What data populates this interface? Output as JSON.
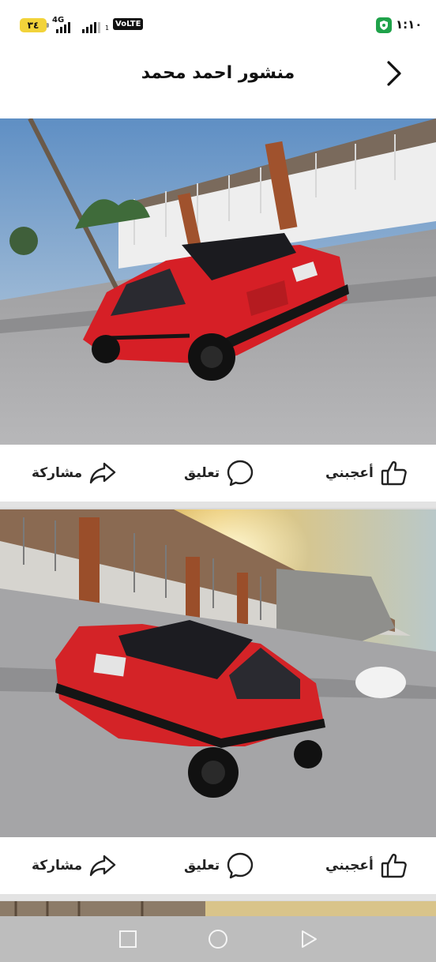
{
  "status_bar": {
    "battery_level": "٣٤",
    "network_type": "4G",
    "volte_label": "VoLTE",
    "sim_index": "1",
    "time": "١:١٠"
  },
  "header": {
    "title": "منشور احمد محمد"
  },
  "posts": [
    {
      "like_label": "أعجبني",
      "comment_label": "تعليق",
      "share_label": "مشاركة"
    },
    {
      "like_label": "أعجبني",
      "comment_label": "تعليق",
      "share_label": "مشاركة"
    }
  ],
  "colors": {
    "car_red": "#e0242a",
    "vpn_green": "#1fa24a",
    "battery_yellow": "#f2d33a",
    "nav_bar": "#bdbdbd"
  },
  "icons": {
    "back": "chevron-right-icon",
    "like": "thumbs-up-icon",
    "comment": "speech-bubble-icon",
    "share": "share-arrow-icon",
    "nav_recents": "square-icon",
    "nav_home": "circle-icon",
    "nav_back": "triangle-icon"
  }
}
